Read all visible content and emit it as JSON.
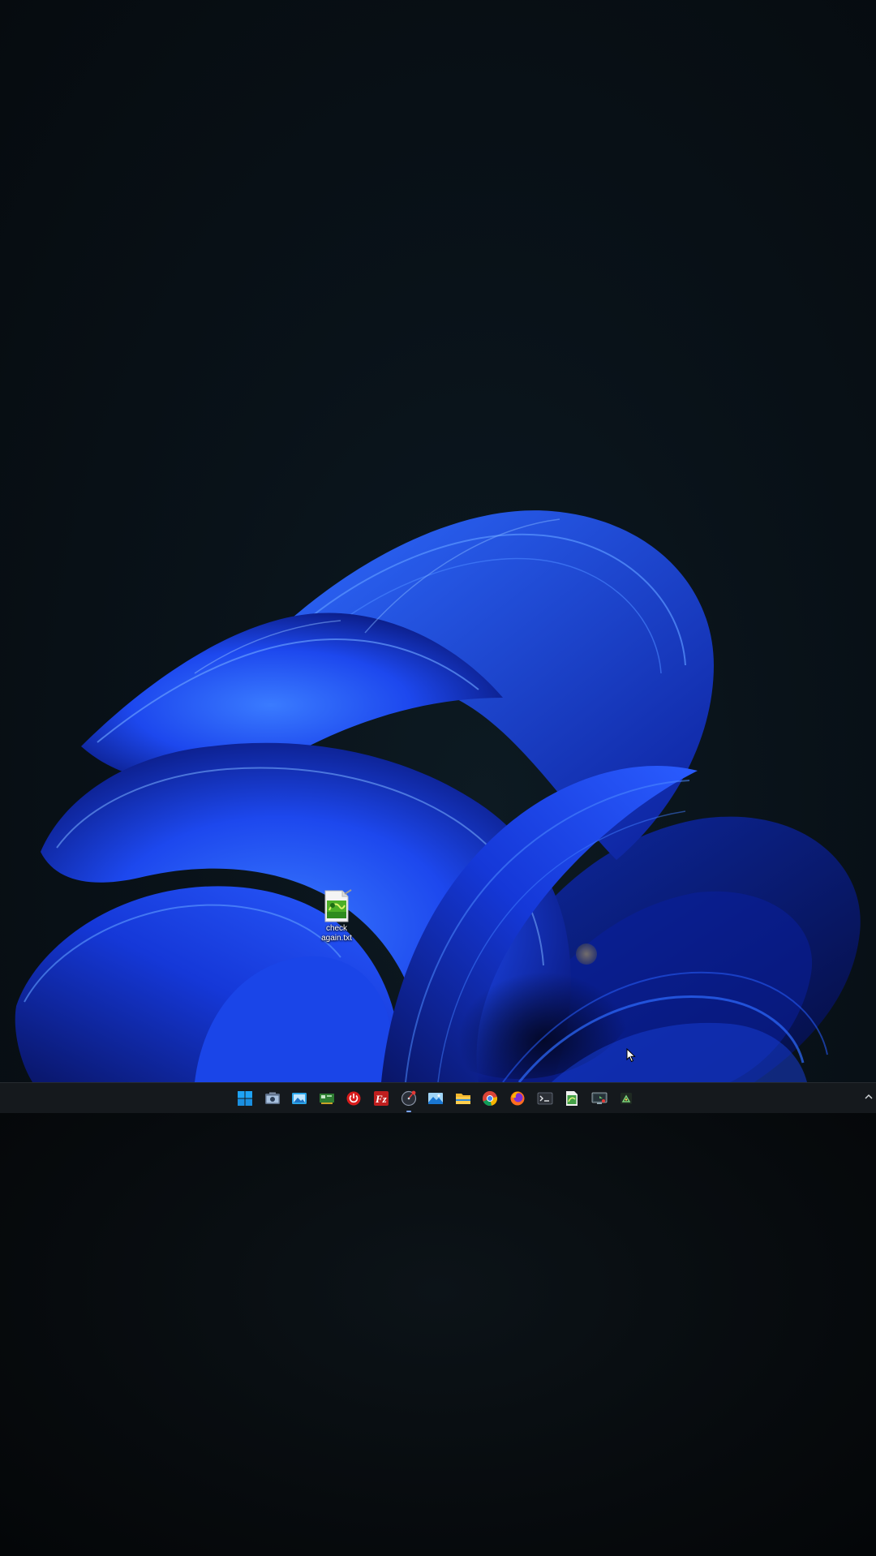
{
  "desktop": {
    "icons": [
      {
        "label": "check again.txt",
        "icon": "notepad-file-icon"
      }
    ]
  },
  "taskbar": {
    "apps": [
      {
        "name": "start-button",
        "icon": "windows-logo-icon"
      },
      {
        "name": "taskbar-app-2",
        "icon": "camera-app-icon"
      },
      {
        "name": "taskbar-app-3",
        "icon": "photo-viewer-icon"
      },
      {
        "name": "taskbar-app-4",
        "icon": "network-card-icon"
      },
      {
        "name": "taskbar-app-5",
        "icon": "red-power-icon"
      },
      {
        "name": "taskbar-app-filezilla",
        "icon": "filezilla-icon"
      },
      {
        "name": "taskbar-app-7",
        "icon": "gauge-icon",
        "active": true
      },
      {
        "name": "taskbar-app-8",
        "icon": "image-app-icon"
      },
      {
        "name": "taskbar-app-file-explorer",
        "icon": "folder-icon"
      },
      {
        "name": "taskbar-app-chrome",
        "icon": "chrome-icon"
      },
      {
        "name": "taskbar-app-firefox",
        "icon": "firefox-icon"
      },
      {
        "name": "taskbar-app-terminal",
        "icon": "terminal-icon"
      },
      {
        "name": "taskbar-app-13",
        "icon": "green-file-icon"
      },
      {
        "name": "taskbar-app-14",
        "icon": "remote-desktop-icon"
      },
      {
        "name": "taskbar-app-15",
        "icon": "small-utility-icon"
      }
    ],
    "tray": {
      "icon": "chevron-up-icon"
    }
  },
  "colors": {
    "wallpaper_blue": "#1f4ef5",
    "wallpaper_dark": "#0a1218",
    "taskbar_bg": "#15191d"
  }
}
